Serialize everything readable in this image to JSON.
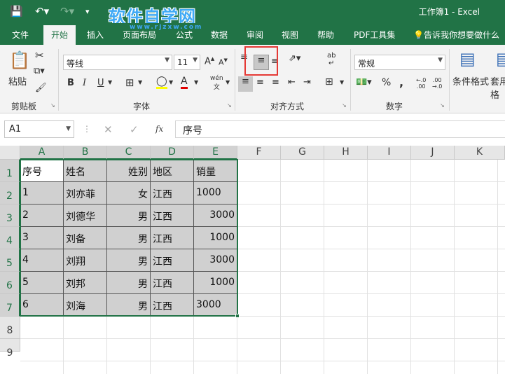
{
  "title_bar": {
    "doc_title": "工作簿1  -  Excel",
    "watermark": "软件自学网",
    "watermark_url": "www.rjzxw.com"
  },
  "tabs": [
    "文件",
    "开始",
    "插入",
    "页面布局",
    "公式",
    "数据",
    "审阅",
    "视图",
    "帮助",
    "PDF工具集",
    "告诉我你想要做什么"
  ],
  "ribbon": {
    "clipboard_label": "剪贴板",
    "paste_label": "粘贴",
    "font_label": "字体",
    "font_name": "等线",
    "font_size": "11",
    "wen_label": "wén",
    "align_label": "对齐方式",
    "number_label": "数字",
    "number_format": "常规",
    "percent": "%",
    "comma": ",",
    "cond_format_label": "条件格式",
    "table_fmt_label": "套用表格"
  },
  "formula_bar": {
    "name_box": "A1",
    "fx": "fx",
    "content": "序号"
  },
  "columns": [
    "A",
    "B",
    "C",
    "D",
    "E",
    "F",
    "G",
    "H",
    "I",
    "J",
    "K"
  ],
  "rows": [
    "1",
    "2",
    "3",
    "4",
    "5",
    "6",
    "7",
    "8",
    "9"
  ],
  "table": {
    "header": [
      "序号",
      "姓名",
      "姓别",
      "地区",
      "销量"
    ],
    "data": [
      [
        "1",
        "刘亦菲",
        "女",
        "江西",
        "1000"
      ],
      [
        "2",
        "刘德华",
        "男",
        "江西",
        "3000"
      ],
      [
        "3",
        "刘备",
        "男",
        "江西",
        "1000"
      ],
      [
        "4",
        "刘翔",
        "男",
        "江西",
        "3000"
      ],
      [
        "5",
        "刘邦",
        "男",
        "江西",
        "1000"
      ],
      [
        "6",
        "刘海",
        "男",
        "江西",
        "3000"
      ]
    ]
  },
  "colors": {
    "excel_green": "#217346",
    "highlight_red": "#e53935"
  }
}
